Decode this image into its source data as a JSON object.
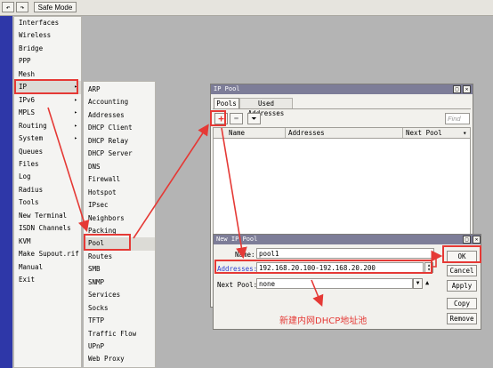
{
  "toolbar": {
    "undo_icon": "undo-icon",
    "redo_icon": "redo-icon",
    "safe_mode_label": "Safe Mode"
  },
  "main_menu": {
    "items": [
      "Interfaces",
      "Wireless",
      "Bridge",
      "PPP",
      "Mesh",
      "IP",
      "IPv6",
      "MPLS",
      "Routing",
      "System",
      "Queues",
      "Files",
      "Log",
      "Radius",
      "Tools",
      "New Terminal",
      "ISDN Channels",
      "KVM",
      "Make Supout.rif",
      "Manual",
      "Exit"
    ],
    "submenu_indicators": {
      "IP": "▸",
      "IPv6": "▸",
      "MPLS": "▸",
      "Routing": "▸",
      "System": "▸"
    },
    "selected": "IP"
  },
  "ip_submenu": {
    "items": [
      "ARP",
      "Accounting",
      "Addresses",
      "DHCP Client",
      "DHCP Relay",
      "DHCP Server",
      "DNS",
      "Firewall",
      "Hotspot",
      "IPsec",
      "Neighbors",
      "Packing",
      "Pool",
      "Routes",
      "SMB",
      "SNMP",
      "Services",
      "Socks",
      "TFTP",
      "Traffic Flow",
      "UPnP",
      "Web Proxy"
    ],
    "selected": "Pool"
  },
  "pool_window": {
    "title": "IP Pool",
    "tabs": [
      "Pools",
      "Used Addresses"
    ],
    "active_tab": "Pools",
    "find_placeholder": "Find",
    "columns": [
      "Name",
      "Addresses",
      "Next Pool"
    ]
  },
  "new_pool_dialog": {
    "title": "New IP Pool",
    "name_label": "Name:",
    "name_value": "pool1",
    "addresses_label": "Addresses:",
    "addresses_value": "192.168.20.100-192.168.20.200",
    "next_pool_label": "Next Pool:",
    "next_pool_value": "none",
    "buttons": {
      "ok": "OK",
      "cancel": "Cancel",
      "apply": "Apply",
      "copy": "Copy",
      "remove": "Remove"
    }
  },
  "annotation": "新建内网DHCP地址池",
  "colors": {
    "accent_red": "#e53935",
    "title_bar": "#7d7d98",
    "left_strip": "#2e37a8"
  }
}
